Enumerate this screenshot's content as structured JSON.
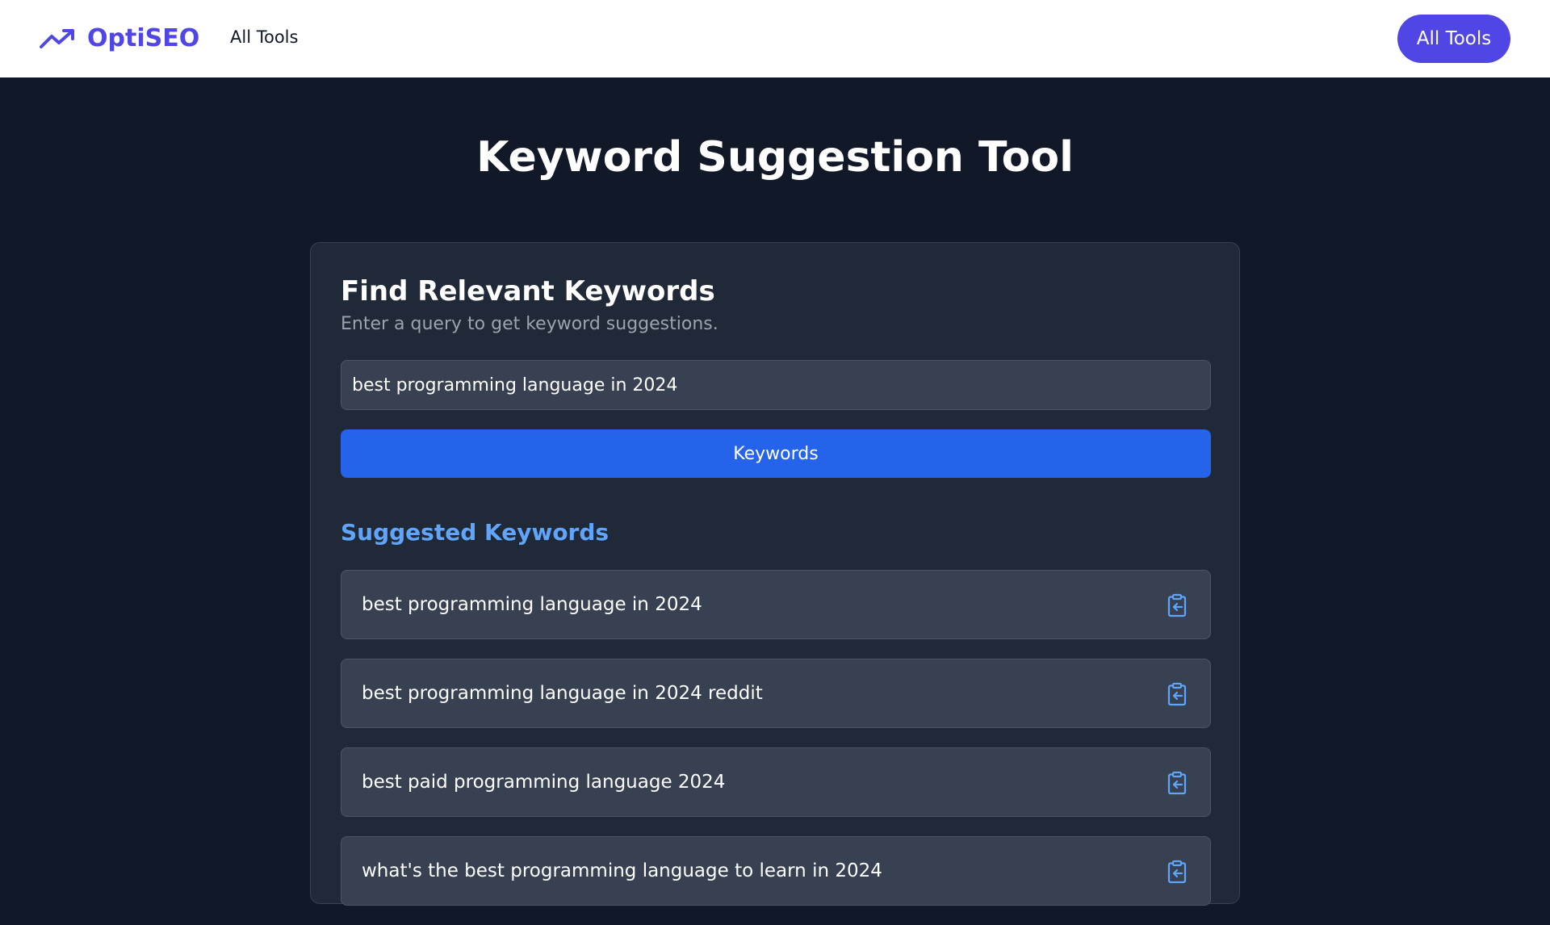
{
  "navbar": {
    "brand": "OptiSEO",
    "link": "All Tools",
    "cta": "All Tools"
  },
  "page": {
    "title": "Keyword Suggestion Tool"
  },
  "card": {
    "title": "Find Relevant Keywords",
    "subtitle": "Enter a query to get keyword suggestions.",
    "query_value": "best programming language in 2024",
    "button_label": "Keywords"
  },
  "results": {
    "title": "Suggested Keywords",
    "items": [
      "best programming language in 2024",
      "best programming language in 2024 reddit",
      "best paid programming language 2024",
      "what's the best programming language to learn in 2024"
    ]
  },
  "colors": {
    "accent": "#4f46e5",
    "primary_button": "#2563eb",
    "section_title": "#60a5fa",
    "background": "#111827",
    "card": "#1f2937"
  },
  "icons": {
    "brand": "trending-up-icon",
    "copy": "clipboard-copy-icon"
  }
}
